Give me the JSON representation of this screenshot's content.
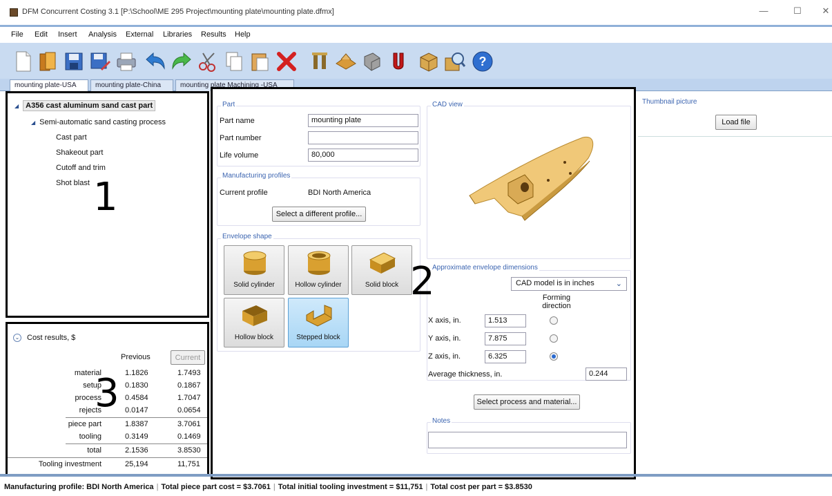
{
  "window": {
    "title": "DFM Concurrent Costing 3.1 [P:\\School\\ME 295 Project\\mounting plate\\mounting plate.dfmx]",
    "minimize": "—",
    "maximize": "☐",
    "close": "✕"
  },
  "menu": [
    "File",
    "Edit",
    "Insert",
    "Analysis",
    "External",
    "Libraries",
    "Results",
    "Help"
  ],
  "toolbar": [
    "new-icon",
    "open-icon",
    "save-icon",
    "save-as-icon",
    "print-icon",
    "undo-icon",
    "redo-icon",
    "cut-icon",
    "copy-icon",
    "paste-icon",
    "delete-icon",
    "process-icon",
    "material-icon",
    "part-icon",
    "magnet-icon",
    "box-icon",
    "zoom-icon",
    "help-icon"
  ],
  "tabs": [
    "mounting plate-USA",
    "mounting plate-China",
    "mounting plate Machining -USA"
  ],
  "tree": {
    "root": "A356 cast aluminum sand cast part",
    "process": "Semi-automatic sand casting process",
    "steps": [
      "Cast part",
      "Shakeout part",
      "Cutoff and trim",
      "Shot blast"
    ]
  },
  "annotations": {
    "one": "1",
    "two": "2",
    "three": "3"
  },
  "part": {
    "group_title": "Part",
    "name_label": "Part name",
    "name_value": "mounting plate",
    "number_label": "Part number",
    "number_value": "",
    "volume_label": "Life volume",
    "volume_value": "80,000"
  },
  "profiles": {
    "group_title": "Manufacturing profiles",
    "current_label": "Current profile",
    "current_value": "BDI North America",
    "select_button": "Select a different profile..."
  },
  "envelope": {
    "group_title": "Envelope shape",
    "shapes": [
      "Solid cylinder",
      "Hollow cylinder",
      "Solid block",
      "Hollow block",
      "Stepped block"
    ],
    "selected": "Stepped block"
  },
  "cad": {
    "group_title": "CAD view"
  },
  "dims": {
    "group_title": "Approximate envelope dimensions",
    "units": "CAD model is in inches",
    "forming_header": "Forming direction",
    "x_label": "X axis, in.",
    "x_value": "1.513",
    "y_label": "Y axis, in.",
    "y_value": "7.875",
    "z_label": "Z axis, in.",
    "z_value": "6.325",
    "forming_selected": "Z",
    "thickness_label": "Average thickness, in.",
    "thickness_value": "0.244",
    "select_button": "Select process and material..."
  },
  "notes": {
    "group_title": "Notes",
    "value": ""
  },
  "thumbnail": {
    "group_title": "Thumbnail picture",
    "load_button": "Load file"
  },
  "cost": {
    "header": "Cost results, $",
    "col_previous": "Previous",
    "col_current": "Current",
    "rows": [
      {
        "label": "material",
        "previous": "1.1826",
        "current": "1.7493"
      },
      {
        "label": "setup",
        "previous": "0.1830",
        "current": "0.1867"
      },
      {
        "label": "process",
        "previous": "0.4584",
        "current": "1.7047"
      },
      {
        "label": "rejects",
        "previous": "0.0147",
        "current": "0.0654"
      },
      {
        "label": "piece part",
        "previous": "1.8387",
        "current": "3.7061"
      },
      {
        "label": "tooling",
        "previous": "0.3149",
        "current": "0.1469"
      },
      {
        "label": "total",
        "previous": "2.1536",
        "current": "3.8530"
      },
      {
        "label": "Tooling investment",
        "previous": "25,194",
        "current": "11,751"
      }
    ]
  },
  "status": {
    "profile": "Manufacturing profile: BDI North America",
    "piece": "Total piece part cost = $3.7061",
    "tooling": "Total initial tooling investment = $11,751",
    "per_part": "Total cost per part = $3.8530"
  }
}
